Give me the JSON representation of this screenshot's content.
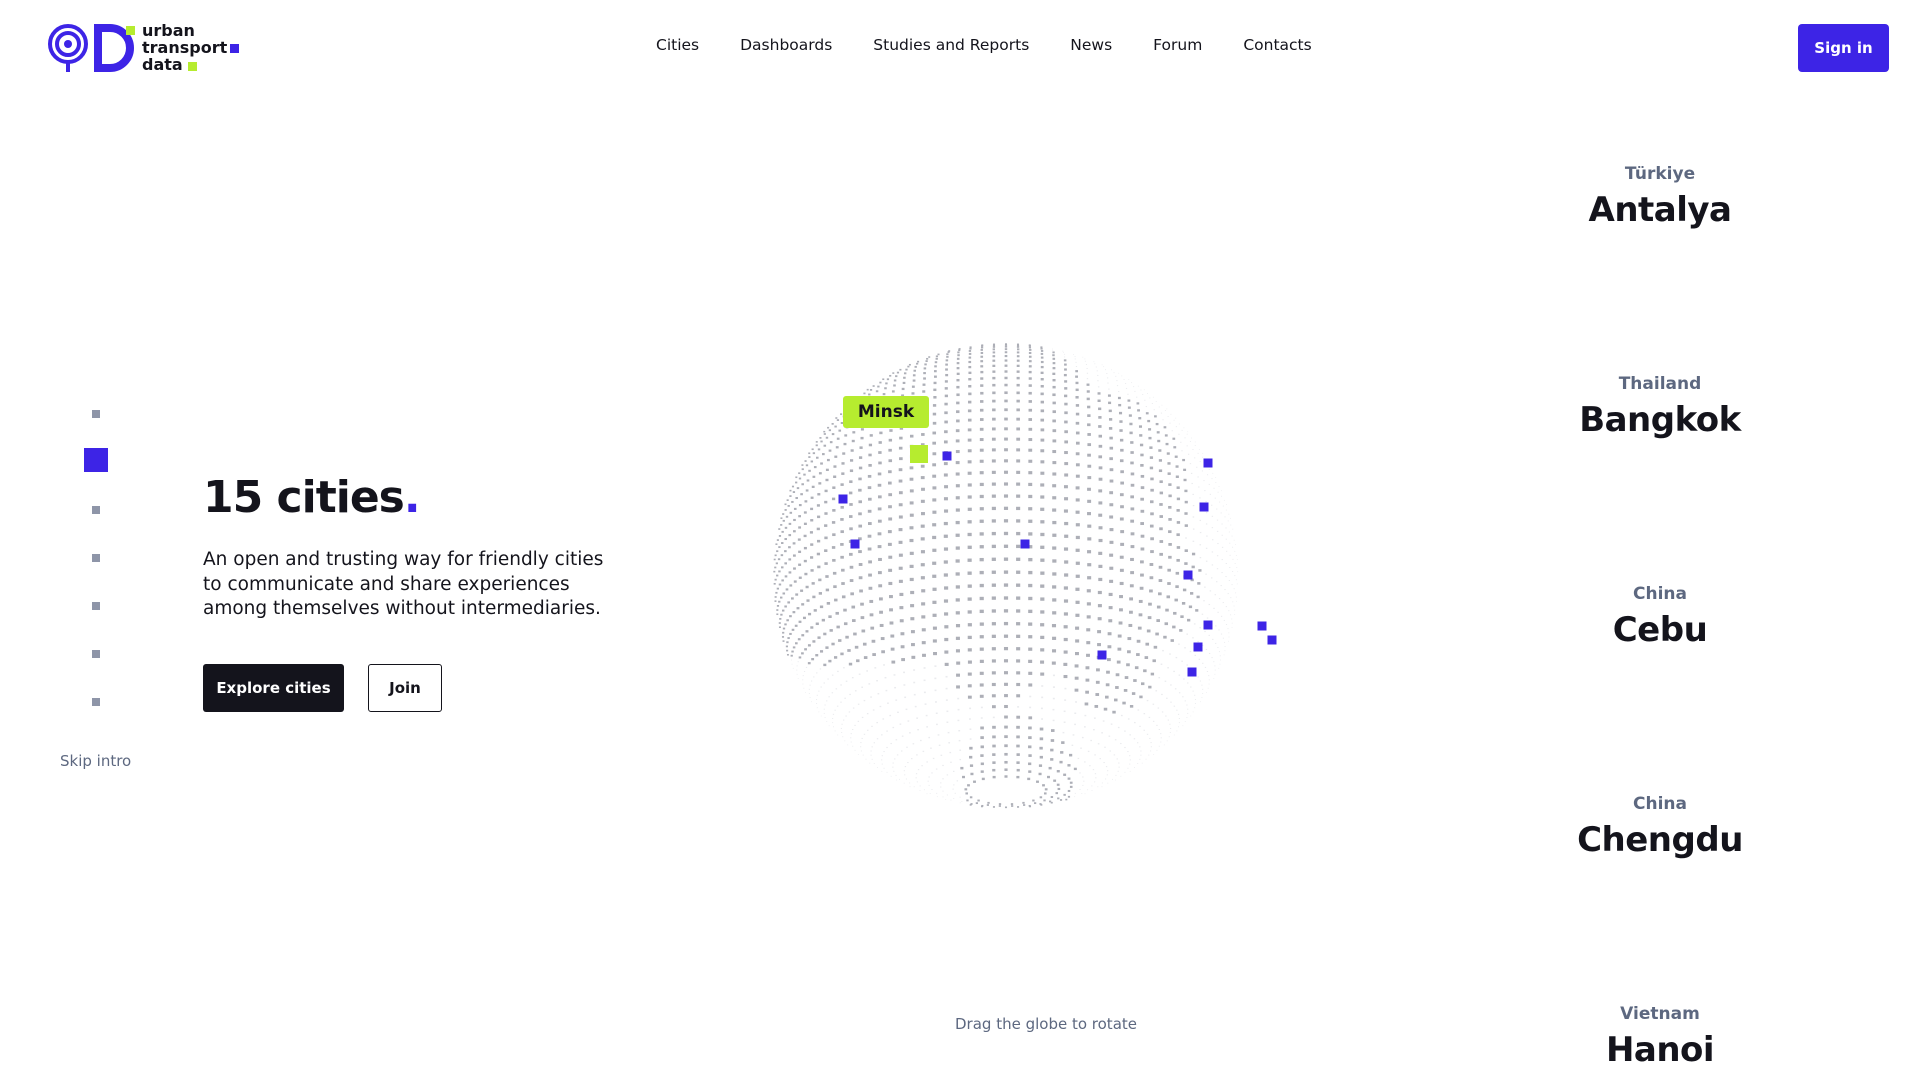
{
  "brand": {
    "name_lines": [
      "urban",
      "transport",
      "data"
    ],
    "colors": {
      "accent": "#3d24e6",
      "lime": "#b6ec2f",
      "ink": "#14141c",
      "muted": "#5d6880"
    }
  },
  "nav": {
    "items": [
      "Cities",
      "Dashboards",
      "Studies and Reports",
      "News",
      "Forum",
      "Contacts"
    ],
    "sign_in": "Sign in"
  },
  "hero": {
    "title": "15 cities",
    "title_dot": ".",
    "description": "An open and trusting way for friendly cities to communicate and share experiences among themselves without intermediaries.",
    "explore_button": "Explore cities",
    "join_button": "Join"
  },
  "pager": {
    "total": 7,
    "active_index": 1,
    "skip_label": "Skip intro"
  },
  "globe": {
    "highlight_label": "Minsk",
    "hint": "Drag the globe to rotate"
  },
  "cities": [
    {
      "country": "Türkiye",
      "name": "Antalya"
    },
    {
      "country": "Thailand",
      "name": "Bangkok"
    },
    {
      "country": "China",
      "name": "Cebu"
    },
    {
      "country": "China",
      "name": "Chengdu"
    },
    {
      "country": "Vietnam",
      "name": "Hanoi"
    }
  ]
}
